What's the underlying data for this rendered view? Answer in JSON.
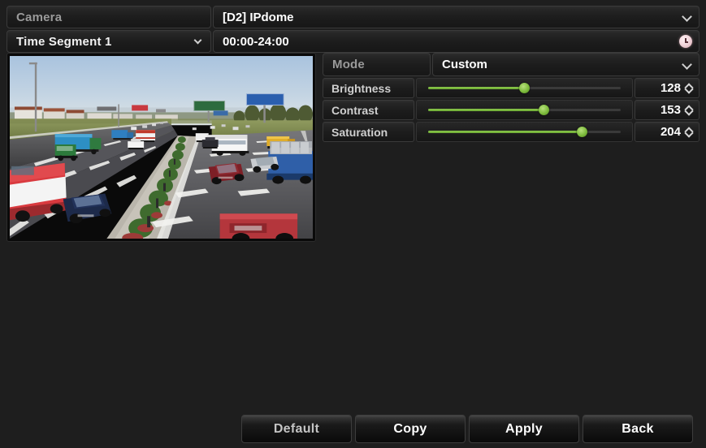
{
  "top": {
    "camera": {
      "label": "Camera",
      "value": "[D2] IPdome",
      "dropdown_icon": "chevron-down-icon"
    },
    "time_segment": {
      "label": "Time Segment 1",
      "value": "00:00-24:00",
      "dropdown_icon": "chevron-down-icon",
      "clock_icon": "clock-icon"
    }
  },
  "preview": {
    "name": "camera-live-preview",
    "description": "Highway traffic scene with multiple lanes, buses, trucks and cars"
  },
  "image_settings": {
    "mode": {
      "label": "Mode",
      "value": "Custom",
      "dropdown_icon": "chevron-down-icon"
    },
    "sliders": [
      {
        "label": "Brightness",
        "value": "128",
        "percent": 50
      },
      {
        "label": "Contrast",
        "value": "153",
        "percent": 60
      },
      {
        "label": "Saturation",
        "value": "204",
        "percent": 80
      }
    ]
  },
  "buttons": [
    {
      "label": "Default",
      "name": "default-button",
      "muted": true
    },
    {
      "label": "Copy",
      "name": "copy-button",
      "muted": false
    },
    {
      "label": "Apply",
      "name": "apply-button",
      "muted": false
    },
    {
      "label": "Back",
      "name": "back-button",
      "muted": false
    }
  ],
  "colors": {
    "background": "#1e1e1e",
    "slider_accent": "#7dbb3c",
    "field_border": "#3a3a3a",
    "text_primary": "#ffffff",
    "text_dim": "#9a9a9a",
    "clock_icon": "#f0d6db"
  }
}
